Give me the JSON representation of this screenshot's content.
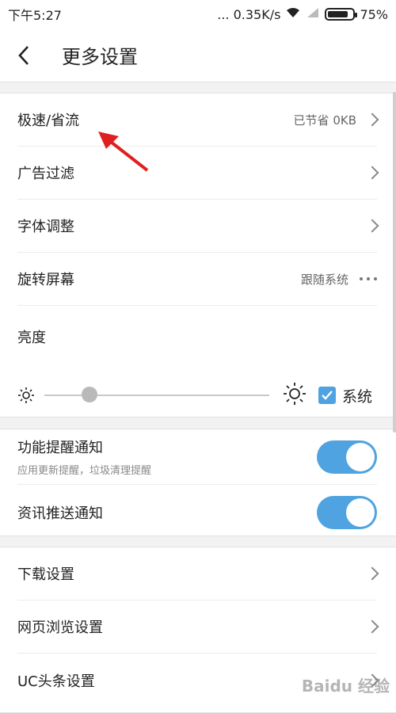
{
  "status_bar": {
    "time": "下午5:27",
    "network_speed": "... 0.35K/s",
    "battery": "75%"
  },
  "header": {
    "back_icon": "chevron-left-icon",
    "title": "更多设置"
  },
  "group1": {
    "items": [
      {
        "label": "极速/省流",
        "value": "已节省 0KB",
        "icon": "chevron-right-icon"
      },
      {
        "label": "广告过滤",
        "value": "",
        "icon": "chevron-right-icon"
      },
      {
        "label": "字体调整",
        "value": "",
        "icon": "chevron-right-icon"
      },
      {
        "label": "旋转屏幕",
        "value": "跟随系统",
        "icon": "more-dots-icon"
      }
    ],
    "brightness": {
      "label": "亮度",
      "level_fraction": 0.2,
      "system_checkbox_label": "系统",
      "system_checked": true
    }
  },
  "group2": {
    "items": [
      {
        "label": "功能提醒通知",
        "sublabel": "应用更新提醒，垃圾清理提醒",
        "enabled": true
      },
      {
        "label": "资讯推送通知",
        "sublabel": "",
        "enabled": true
      }
    ]
  },
  "group3": {
    "items": [
      {
        "label": "下载设置",
        "icon": "chevron-right-icon"
      },
      {
        "label": "网页浏览设置",
        "icon": "chevron-right-icon"
      },
      {
        "label": "UC头条设置",
        "icon": "chevron-right-icon"
      }
    ]
  },
  "watermark": "Baidu 经验",
  "colors": {
    "accent": "#4fa3e0",
    "annotation_arrow": "#e02020"
  }
}
